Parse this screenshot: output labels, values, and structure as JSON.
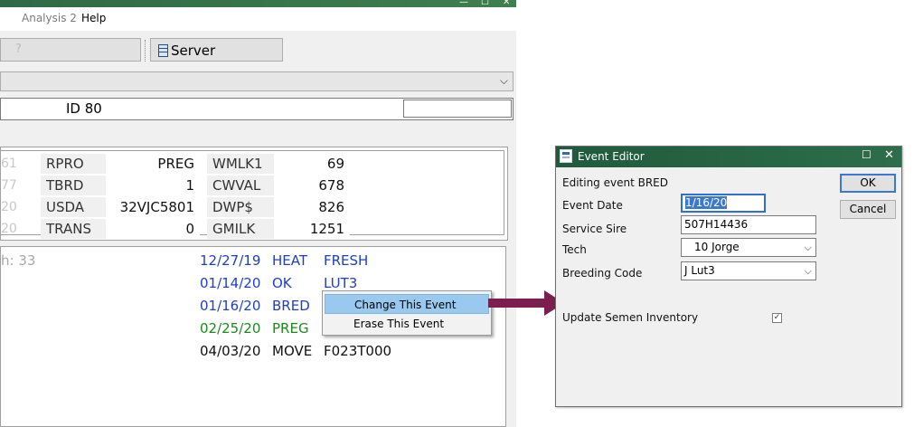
{
  "menu": {
    "items": [
      "Analysis 2",
      "Help"
    ]
  },
  "toolbar": {
    "server_label": "Server"
  },
  "id_row": {
    "label": "ID 80"
  },
  "stats": {
    "ghost_rows": [
      "61",
      "77",
      "20",
      "20"
    ],
    "rows": [
      {
        "k1": "RPRO",
        "v1": "PREG",
        "k2": "WMLK1",
        "v2": "69"
      },
      {
        "k1": "TBRD",
        "v1": "1",
        "k2": "CWVAL",
        "v2": "678"
      },
      {
        "k1": "USDA",
        "v1": "32VJC5801",
        "k2": "DWP$",
        "v2": "826"
      },
      {
        "k1": "TRANS",
        "v1": "0",
        "k2": "GMILK",
        "v2": "1251"
      }
    ]
  },
  "events": {
    "header_fragment": "h: 33",
    "rows": [
      {
        "date": "12/27/19",
        "code": "HEAT",
        "detail": "FRESH",
        "color": "#1f3fbf"
      },
      {
        "date": "01/14/20",
        "code": "OK",
        "detail": "LUT3",
        "color": "#1f3fbf"
      },
      {
        "date": "01/16/20",
        "code": "BRED",
        "detail": "",
        "color": "#1f3fbf"
      },
      {
        "date": "02/25/20",
        "code": "PREG",
        "detail": "",
        "color": "#1b8a1b"
      },
      {
        "date": "04/03/20",
        "code": "MOVE",
        "detail": "F023T000",
        "color": "#111111"
      }
    ]
  },
  "context_menu": {
    "items": [
      "Change This Event",
      "Erase This Event"
    ],
    "highlighted": "Change This Event"
  },
  "arrow": {
    "color": "#7a1f4f"
  },
  "dialog": {
    "title": "Event Editor",
    "subtitle": "Editing event BRED",
    "event_date_label": "Event Date",
    "event_date_value": "1/16/20",
    "service_sire_label": "Service Sire",
    "service_sire_value": "507H14436",
    "tech_label": "Tech",
    "tech_value": "10  Jorge",
    "breeding_code_label": "Breeding Code",
    "breeding_code_value": "J  Lut3",
    "update_semen_label": "Update Semen Inventory",
    "update_semen_checked": true,
    "ok_label": "OK",
    "cancel_label": "Cancel",
    "title_bar_color": "#1f5a3c"
  }
}
